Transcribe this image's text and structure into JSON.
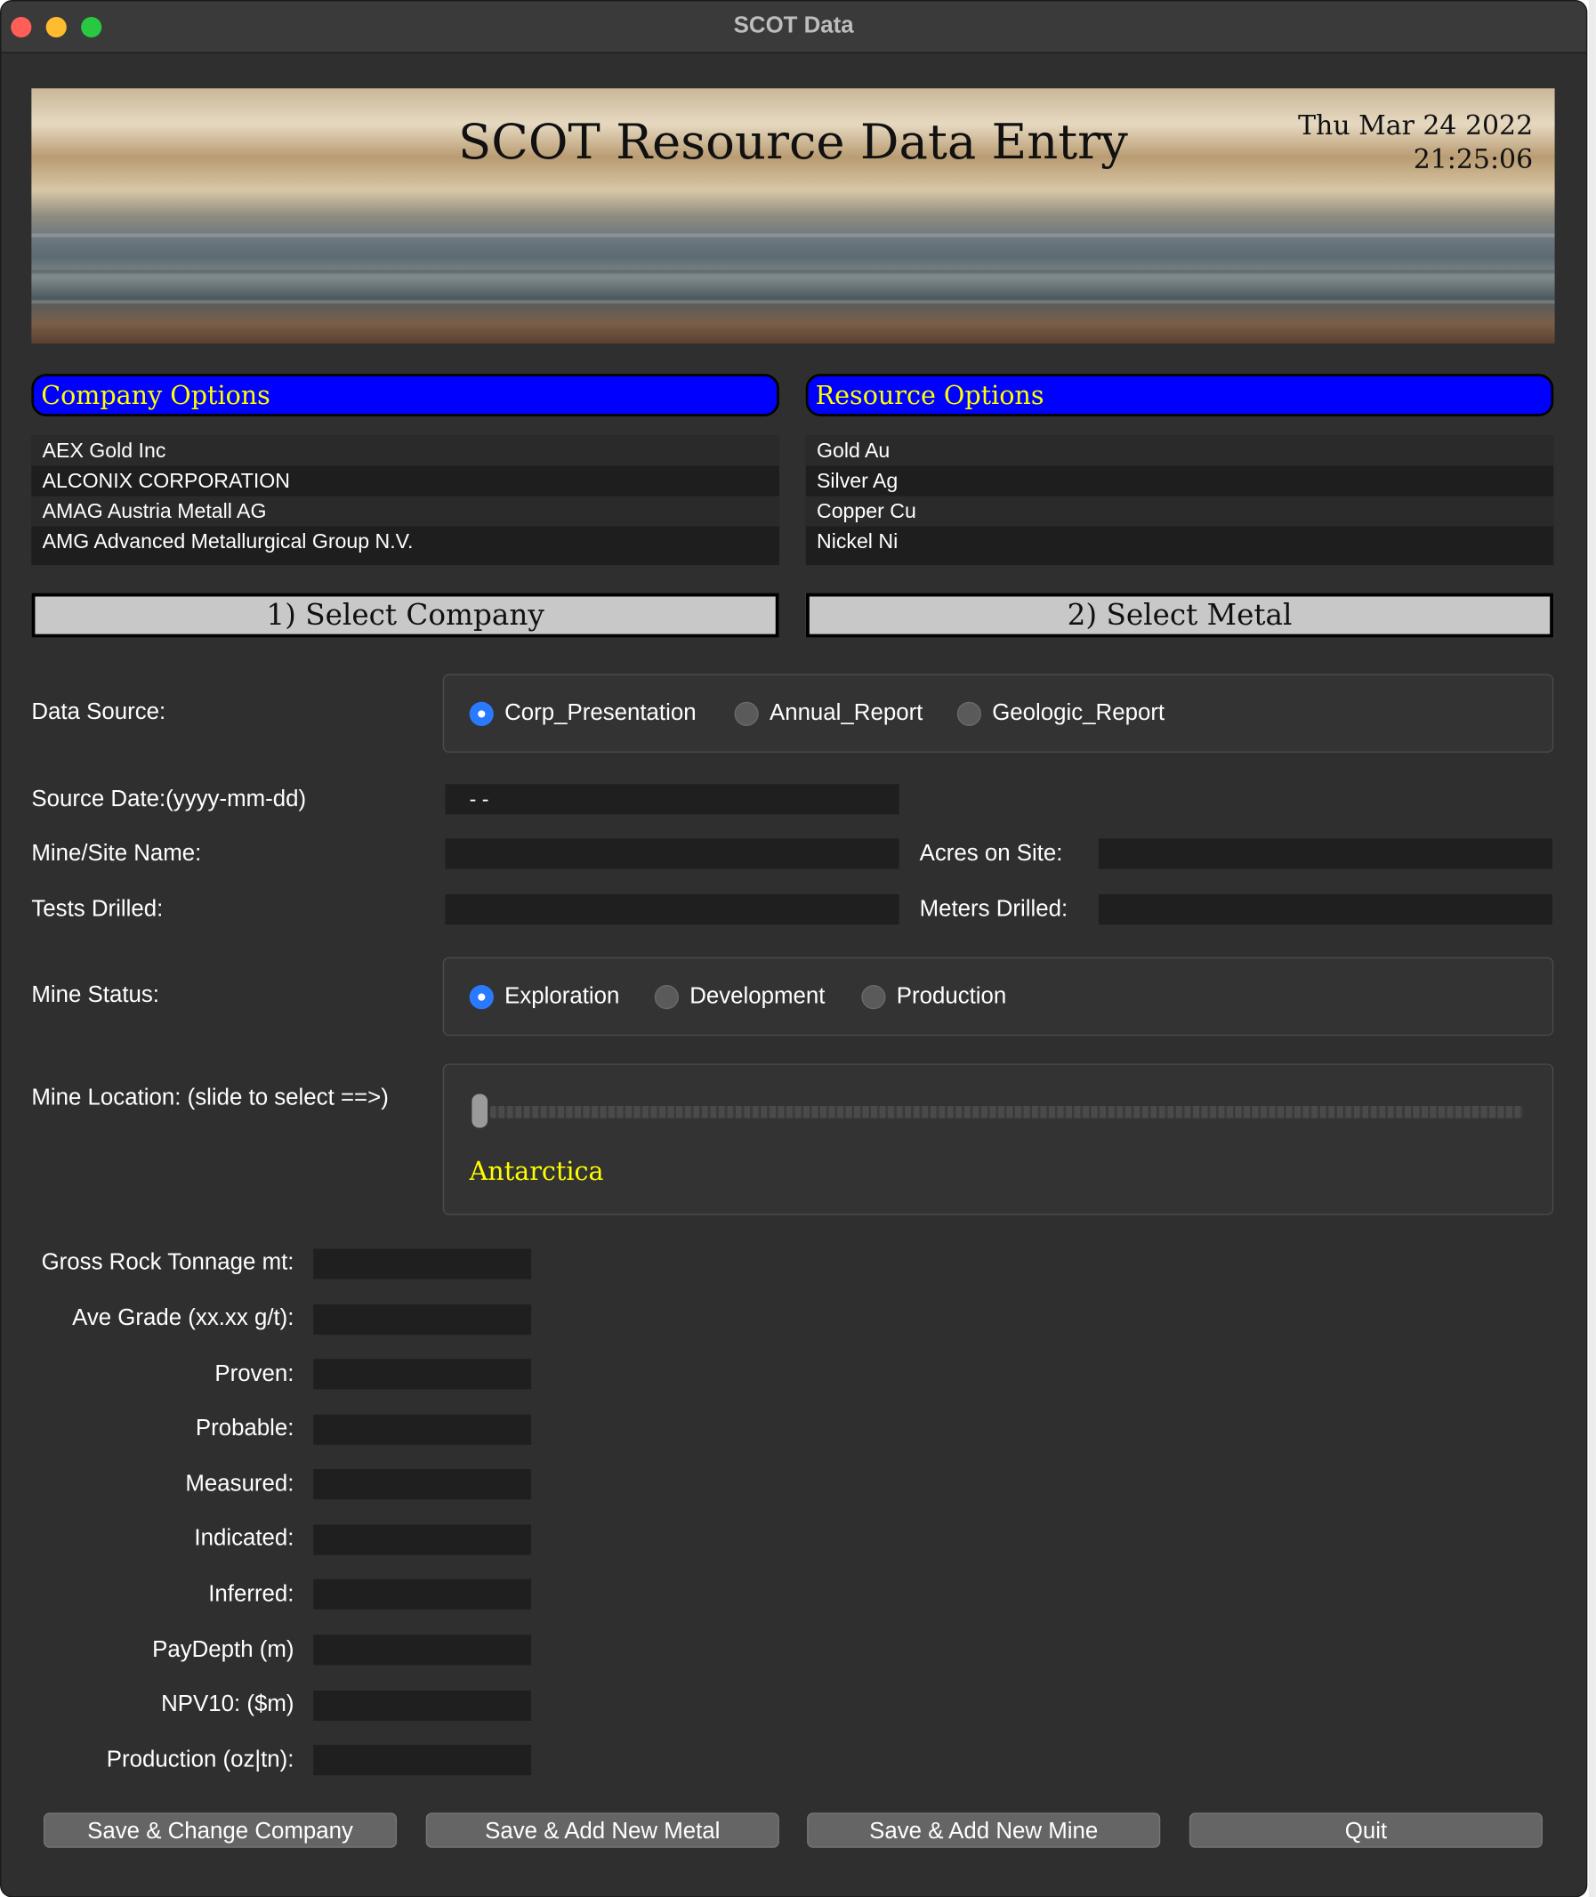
{
  "window": {
    "title": "SCOT Data"
  },
  "banner": {
    "title": "SCOT Resource Data Entry",
    "date": "Thu Mar 24 2022",
    "time": "21:25:06"
  },
  "company": {
    "header": "Company Options",
    "items": [
      "AEX Gold Inc",
      "ALCONIX CORPORATION",
      "AMAG Austria Metall AG",
      "AMG Advanced Metallurgical Group N.V."
    ],
    "select_label": "1) Select Company"
  },
  "resource": {
    "header": "Resource Options",
    "items": [
      "Gold Au",
      "Silver Ag",
      "Copper Cu",
      "Nickel Ni"
    ],
    "select_label": "2) Select Metal"
  },
  "data_source": {
    "label": "Data Source:",
    "options": [
      "Corp_Presentation",
      "Annual_Report",
      "Geologic_Report"
    ],
    "selected": "Corp_Presentation"
  },
  "source_date": {
    "label": "Source Date:(yyyy-mm-dd)",
    "value": "-  -"
  },
  "mine_name": {
    "label": "Mine/Site Name:",
    "value": ""
  },
  "acres": {
    "label": "Acres on Site:",
    "value": ""
  },
  "tests": {
    "label": "Tests Drilled:",
    "value": ""
  },
  "meters": {
    "label": "Meters Drilled:",
    "value": ""
  },
  "mine_status": {
    "label": "Mine Status:",
    "options": [
      "Exploration",
      "Development",
      "Production"
    ],
    "selected": "Exploration"
  },
  "mine_location": {
    "label": "Mine Location: (slide to select ==>)",
    "value": "Antarctica",
    "slider_position": 0
  },
  "metrics": [
    {
      "label": "Gross Rock Tonnage mt:",
      "value": ""
    },
    {
      "label": "Ave Grade (xx.xx g/t):",
      "value": ""
    },
    {
      "label": "Proven:",
      "value": ""
    },
    {
      "label": "Probable:",
      "value": ""
    },
    {
      "label": "Measured:",
      "value": ""
    },
    {
      "label": "Indicated:",
      "value": ""
    },
    {
      "label": "Inferred:",
      "value": ""
    },
    {
      "label": "PayDepth (m)",
      "value": ""
    },
    {
      "label": "NPV10: ($m)",
      "value": ""
    },
    {
      "label": "Production (oz|tn):",
      "value": ""
    }
  ],
  "buttons": {
    "save_change_company": "Save & Change Company",
    "save_add_metal": "Save & Add New Metal",
    "save_add_mine": "Save & Add New Mine",
    "quit": "Quit"
  },
  "colors": {
    "header_bg": "#0000ff",
    "header_text": "#ffff00",
    "radio_selected": "#2a7aff",
    "window_bg": "#2f2f2f"
  }
}
